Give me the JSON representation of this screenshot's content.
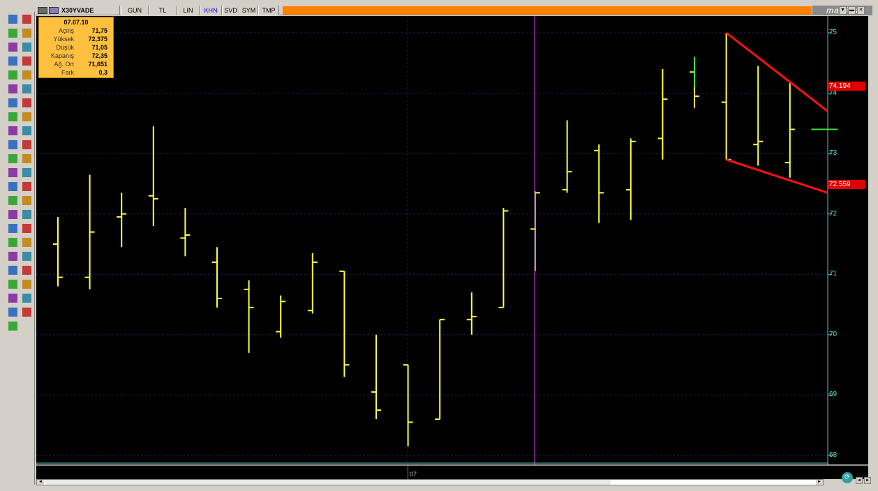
{
  "toolbar": {
    "symbol": "X30YVADE",
    "buttons": [
      "GUN",
      "TL",
      "LIN",
      "KHN",
      "SVD",
      "SYM",
      "TMP"
    ],
    "active_button": "KHN",
    "brand": "matriks",
    "ctl_dropdown": "▼",
    "ctl_min": "▬",
    "ctl_close": "✕"
  },
  "infobox": {
    "date": "07.07.10",
    "rows": [
      {
        "label": "Açılış",
        "value": "71,75"
      },
      {
        "label": "Yüksek",
        "value": "72,375"
      },
      {
        "label": "Düşük",
        "value": "71,05"
      },
      {
        "label": "Kapanış",
        "value": "72,35"
      },
      {
        "label": "Ağ. Ort",
        "value": "71,651"
      },
      {
        "label": "Fark",
        "value": "0,3"
      }
    ]
  },
  "price_tags": {
    "upper": "74.194",
    "lower": "72.559"
  },
  "xaxis": {
    "label": "07"
  },
  "colors": {
    "bar_up": "#ffff40",
    "bar_last": "#40e040",
    "trend": "#ff1010",
    "grid": "#202060",
    "cursor": "#a020a0",
    "axis_text": "#60e0e0",
    "accent": "#ff8000"
  },
  "chart_data": {
    "type": "bar",
    "style": "ohlc",
    "y_ticks": [
      "75",
      "74",
      "73",
      "72",
      "71",
      "70",
      "69",
      "68"
    ],
    "ylim": [
      67.9,
      75.15
    ],
    "ohlc": [
      {
        "o": 71.5,
        "h": 71.95,
        "l": 70.8,
        "c": 70.95
      },
      {
        "o": 70.95,
        "h": 72.65,
        "l": 70.75,
        "c": 71.7
      },
      {
        "o": 71.95,
        "h": 72.35,
        "l": 71.45,
        "c": 72.0
      },
      {
        "o": 72.3,
        "h": 73.45,
        "l": 71.8,
        "c": 72.25
      },
      {
        "o": 71.6,
        "h": 72.1,
        "l": 71.3,
        "c": 71.65
      },
      {
        "o": 71.2,
        "h": 71.45,
        "l": 70.45,
        "c": 70.6
      },
      {
        "o": 70.75,
        "h": 70.9,
        "l": 69.7,
        "c": 70.45
      },
      {
        "o": 70.05,
        "h": 70.65,
        "l": 69.95,
        "c": 70.55
      },
      {
        "o": 70.4,
        "h": 71.35,
        "l": 70.35,
        "c": 71.2
      },
      {
        "o": 71.05,
        "h": 71.05,
        "l": 69.3,
        "c": 69.5
      },
      {
        "o": 69.05,
        "h": 70.0,
        "l": 68.6,
        "c": 68.75
      },
      {
        "o": 69.5,
        "h": 69.5,
        "l": 68.15,
        "c": 68.55
      },
      {
        "o": 68.6,
        "h": 70.25,
        "l": 68.6,
        "c": 70.25
      },
      {
        "o": 70.25,
        "h": 70.7,
        "l": 70.0,
        "c": 70.3
      },
      {
        "o": 70.45,
        "h": 72.1,
        "l": 70.45,
        "c": 72.05
      },
      {
        "o": 71.75,
        "h": 72.375,
        "l": 71.05,
        "c": 72.35
      },
      {
        "o": 72.4,
        "h": 73.55,
        "l": 72.35,
        "c": 72.7
      },
      {
        "o": 73.05,
        "h": 73.15,
        "l": 71.85,
        "c": 72.35
      },
      {
        "o": 72.4,
        "h": 73.25,
        "l": 71.9,
        "c": 73.2
      },
      {
        "o": 73.25,
        "h": 74.4,
        "l": 72.9,
        "c": 73.9
      },
      {
        "o": 74.35,
        "h": 74.6,
        "l": 73.75,
        "c": 73.95
      },
      {
        "o": 73.85,
        "h": 75.0,
        "l": 72.9,
        "c": 72.9
      },
      {
        "o": 73.15,
        "h": 74.45,
        "l": 72.8,
        "c": 73.2
      },
      {
        "o": 72.85,
        "h": 74.2,
        "l": 72.6,
        "c": 73.4
      },
      {
        "o": 73.4,
        "h": 73.4,
        "l": 73.4,
        "c": 73.4
      }
    ]
  }
}
